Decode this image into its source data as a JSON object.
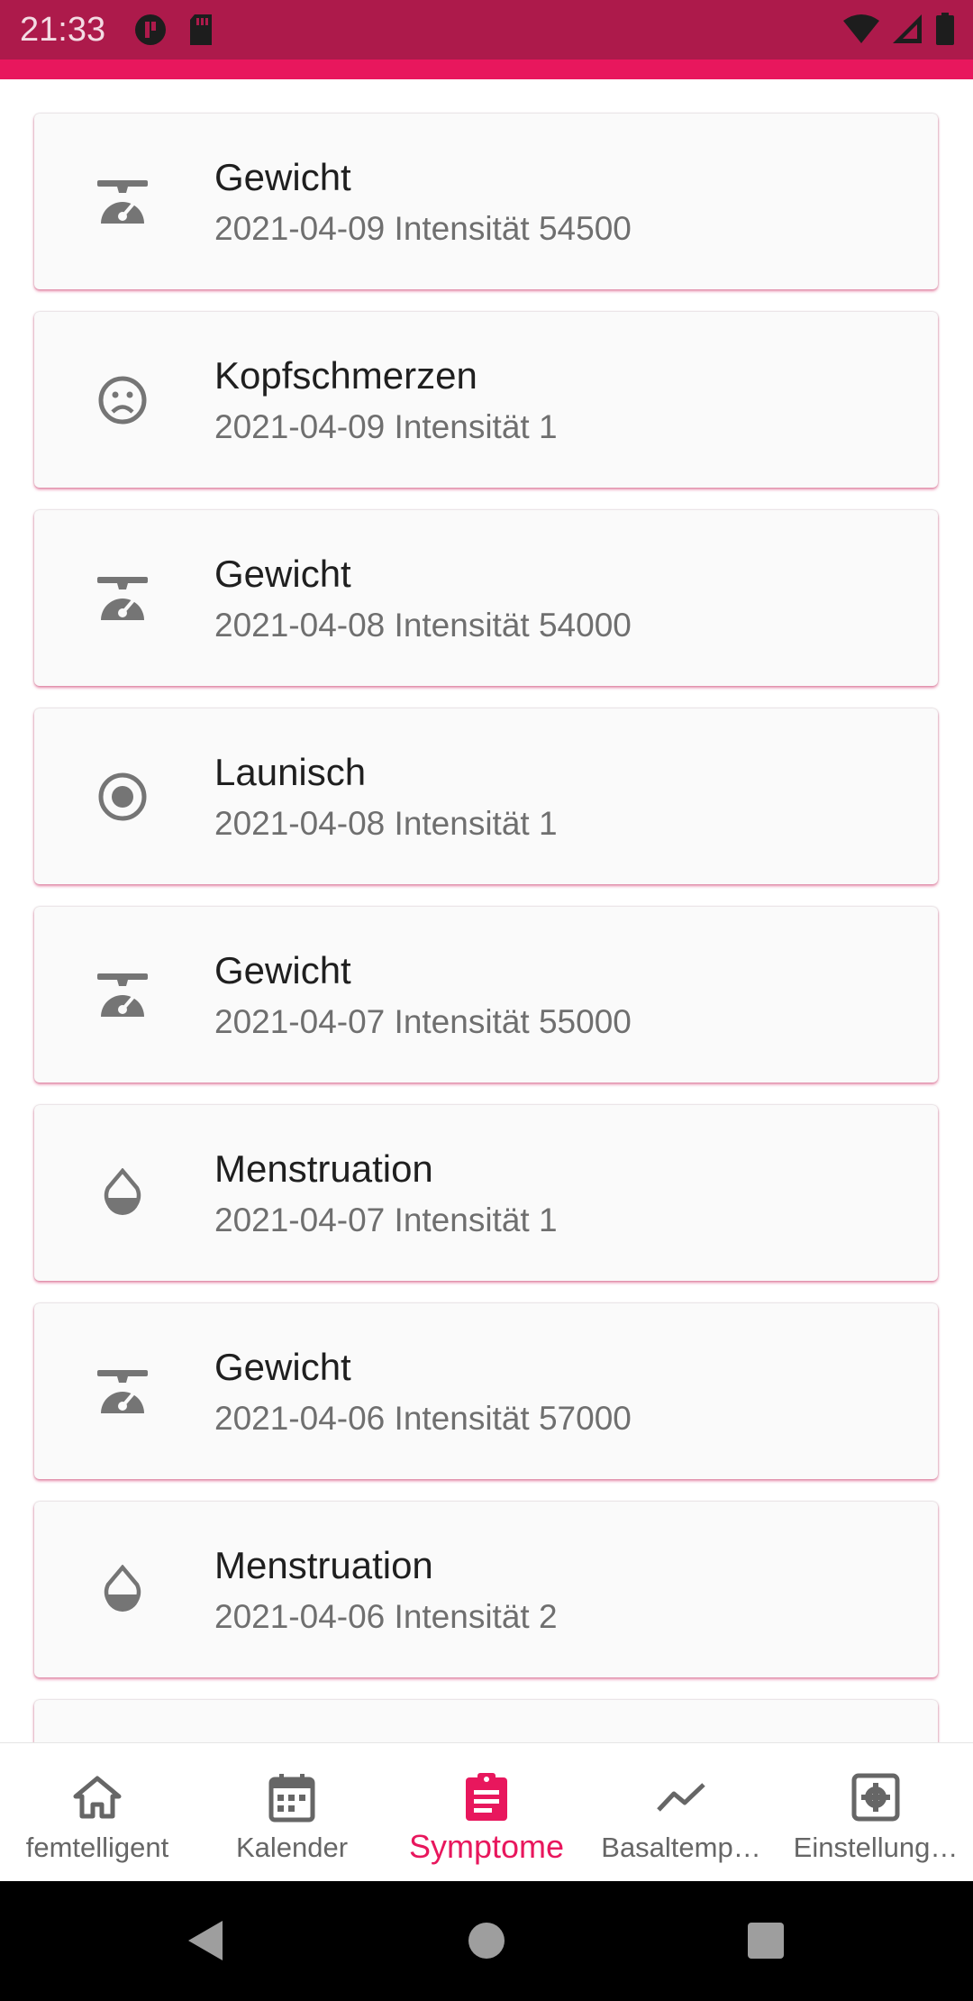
{
  "status_bar": {
    "time": "21:33",
    "left_icons": [
      "app-badge-icon",
      "sd-card-icon"
    ],
    "right_icons": [
      "wifi-icon",
      "signal-icon",
      "battery-icon"
    ],
    "color": "#ad1a4b"
  },
  "accent_color": "#e8175d",
  "entries": [
    {
      "title": "Gewicht",
      "subtitle": "2021-04-09 Intensität 54500",
      "icon": "scale-icon"
    },
    {
      "title": "Kopfschmerzen",
      "subtitle": "2021-04-09 Intensität 1",
      "icon": "sad-face-icon"
    },
    {
      "title": "Gewicht",
      "subtitle": "2021-04-08 Intensität 54000",
      "icon": "scale-icon"
    },
    {
      "title": "Launisch",
      "subtitle": "2021-04-08 Intensität 1",
      "icon": "radio-button-icon"
    },
    {
      "title": "Gewicht",
      "subtitle": "2021-04-07 Intensität 55000",
      "icon": "scale-icon"
    },
    {
      "title": "Menstruation",
      "subtitle": "2021-04-07 Intensität 1",
      "icon": "drop-icon"
    },
    {
      "title": "Gewicht",
      "subtitle": "2021-04-06 Intensität 57000",
      "icon": "scale-icon"
    },
    {
      "title": "Menstruation",
      "subtitle": "2021-04-06 Intensität 2",
      "icon": "drop-icon"
    }
  ],
  "bottom_nav": [
    {
      "label": "femtelligent",
      "icon": "home-icon",
      "active": false
    },
    {
      "label": "Kalender",
      "icon": "calendar-icon",
      "active": false
    },
    {
      "label": "Symptome",
      "icon": "clipboard-icon",
      "active": true
    },
    {
      "label": "Basaltemp…",
      "icon": "trend-line-icon",
      "active": false
    },
    {
      "label": "Einstellung…",
      "icon": "settings-icon",
      "active": false
    }
  ]
}
